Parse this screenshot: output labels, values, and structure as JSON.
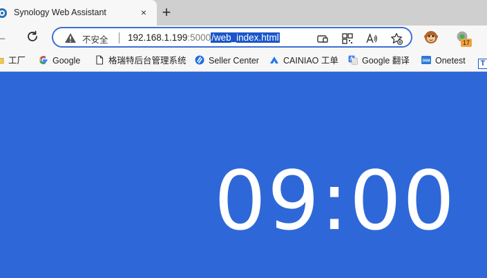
{
  "tab": {
    "title": "Synology Web Assistant",
    "close_icon": "×",
    "new_tab_icon": "+"
  },
  "toolbar": {
    "back_icon": "←",
    "security_label": "不安全",
    "url_host": "192.168.1.199",
    "url_port": ":5000",
    "url_path": "/web_index.html",
    "profile_badge": "17"
  },
  "bookmarks": [
    {
      "label": "工厂",
      "icon": "folder-icon"
    },
    {
      "label": "Google",
      "icon": "google-icon"
    },
    {
      "label": "格瑞特后台管理系统",
      "icon": "page-icon"
    },
    {
      "label": "Seller Center",
      "icon": "seller-center-icon"
    },
    {
      "label": "CAINIAO 工单",
      "icon": "cainiao-icon"
    },
    {
      "label": "Google 翻译",
      "icon": "google-translate-icon"
    },
    {
      "label": "Onetest",
      "icon": "dsm-icon"
    }
  ],
  "bookmark_dsm_text": "DSM",
  "bookmark_overflow_text": "T",
  "page": {
    "time": "09:00",
    "background": "#2e68d8"
  }
}
